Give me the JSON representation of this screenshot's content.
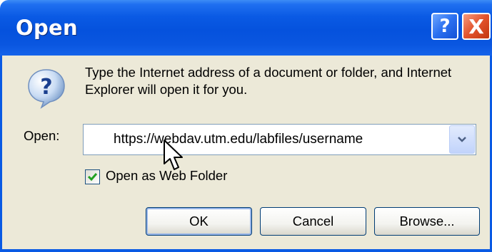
{
  "window": {
    "title": "Open",
    "help_symbol": "?",
    "close_symbol": "X"
  },
  "dialog": {
    "description": "Type the Internet address of a document or folder, and Internet Explorer will open it for you.",
    "open_label": "Open:",
    "url_value": "https://webdav.utm.edu/labfiles/username",
    "checkbox_label": "Open as Web Folder",
    "checkbox_checked": true,
    "icons": {
      "info": "question-icon",
      "dropdown": "chevron-down-icon",
      "pointer": "mouse-cursor-icon"
    }
  },
  "buttons": {
    "ok": "OK",
    "cancel": "Cancel",
    "browse": "Browse..."
  },
  "colors": {
    "titlebar": "#0a5ae4",
    "client": "#ece9d8",
    "close": "#e2532c",
    "help": "#2a6ff0",
    "check": "#21a121"
  }
}
